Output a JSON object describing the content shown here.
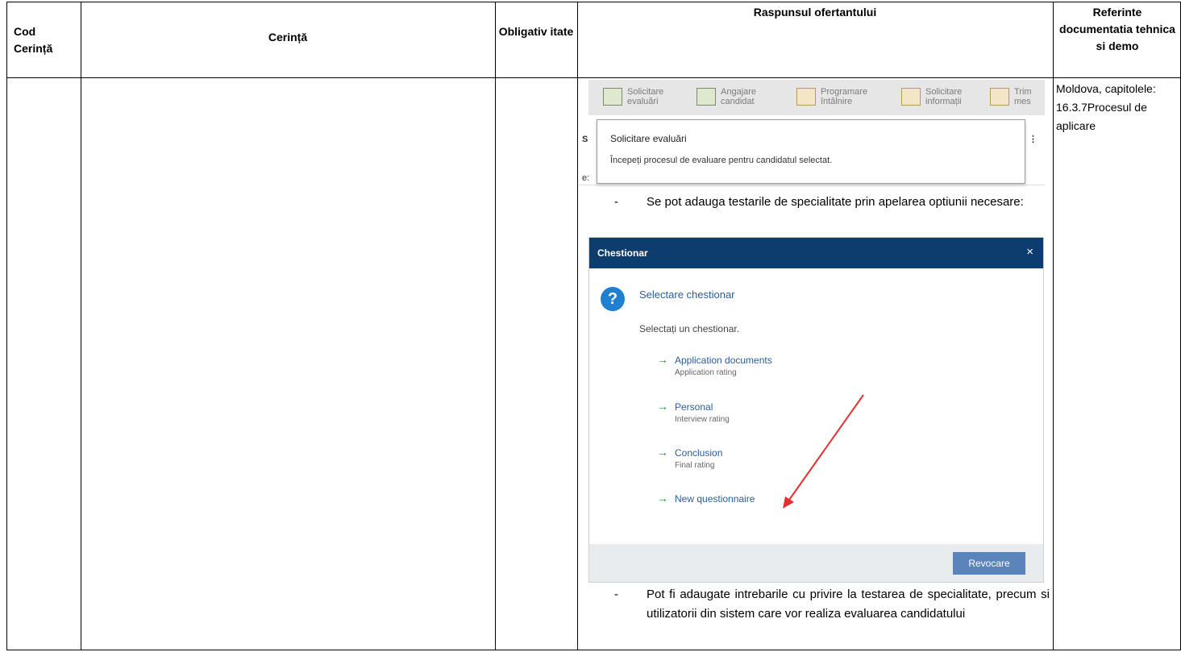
{
  "table": {
    "headers": {
      "cod": "Cod Cerință",
      "cerinta": "Cerință",
      "obligativitate": "Obligativ itate",
      "raspuns": "Raspunsul ofertantului",
      "referinte": "Referinte documentatia tehnica si demo"
    },
    "references": "Moldova, capitolele: 16.3.7Procesul de aplicare",
    "bullets": [
      "Se pot adauga testarile de specialitate prin apelarea optiunii necesare:",
      "Pot fi adaugate intrebarile cu privire la testarea de specialitate, precum si utilizatorii din sistem care vor realiza evaluarea candidatului"
    ]
  },
  "ribbon": {
    "items": [
      {
        "label": "Solicitare evaluări",
        "icon": "clipboard-icon"
      },
      {
        "label": "Angajare candidat",
        "icon": "hire-icon"
      },
      {
        "label": "Programare întâlnire",
        "icon": "envelope-calendar-icon"
      },
      {
        "label": "Solicitare informații",
        "icon": "envelope-question-icon"
      },
      {
        "label": "Trim mes",
        "icon": "envelope-icon"
      }
    ],
    "tooltip": {
      "title": "Solicitare evaluări",
      "description": "Începeți procesul de evaluare pentru candidatul selectat."
    },
    "fragment_left": "S",
    "fragment_left2": "e:"
  },
  "dialog": {
    "title": "Chestionar",
    "close": "×",
    "subtitle": "Selectare chestionar",
    "instruction": "Selectați un chestionar.",
    "options": [
      {
        "label": "Application documents",
        "sub": "Application rating"
      },
      {
        "label": "Personal",
        "sub": "Interview rating"
      },
      {
        "label": "Conclusion",
        "sub": "Final rating"
      },
      {
        "label": "New questionnaire",
        "sub": ""
      }
    ],
    "cancel_label": "Revocare",
    "colors": {
      "header": "#0d3d6e",
      "link": "#2a5d99",
      "arrow": "#2e8b3b",
      "annotation": "#e53030"
    }
  }
}
